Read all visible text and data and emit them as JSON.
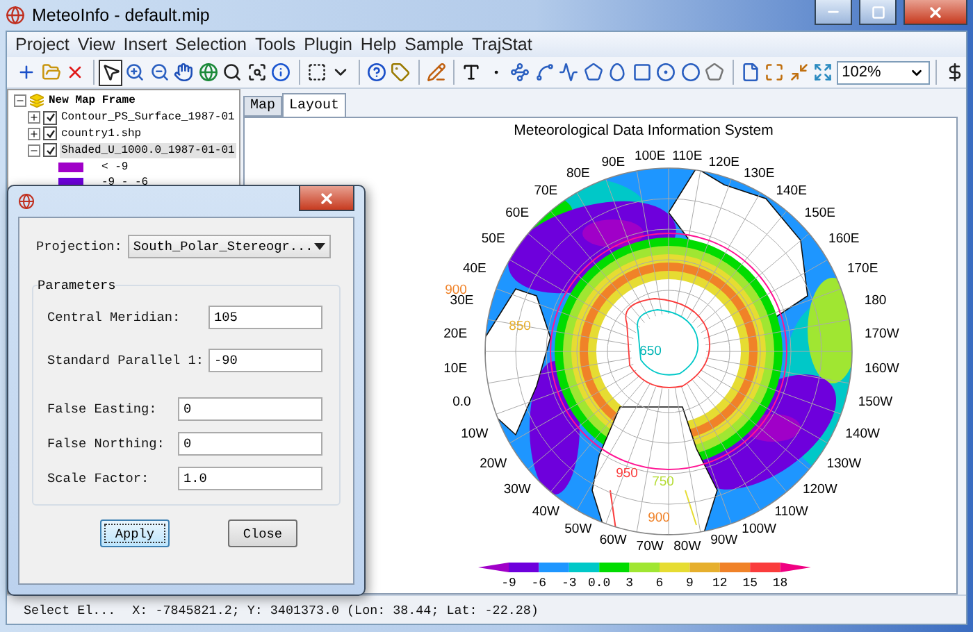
{
  "window": {
    "title": "MeteoInfo - default.mip"
  },
  "menu": [
    "Project",
    "View",
    "Insert",
    "Selection",
    "Tools",
    "Plugin",
    "Help",
    "Sample",
    "TrajStat"
  ],
  "toolbar": [
    {
      "kind": "add-layer",
      "selected": false
    },
    {
      "kind": "open-folder",
      "selected": false
    },
    {
      "kind": "remove-layer",
      "selected": false
    },
    {
      "kind": "separator"
    },
    {
      "kind": "pointer",
      "selected": true
    },
    {
      "kind": "zoom-in",
      "selected": false
    },
    {
      "kind": "zoom-out",
      "selected": false
    },
    {
      "kind": "pan",
      "selected": false
    },
    {
      "kind": "full-extent",
      "selected": false
    },
    {
      "kind": "magnifier",
      "selected": false
    },
    {
      "kind": "zoom-box",
      "selected": false
    },
    {
      "kind": "identify",
      "selected": false
    },
    {
      "kind": "separator"
    },
    {
      "kind": "select-rect",
      "selected": false
    },
    {
      "kind": "caret",
      "selected": false
    },
    {
      "kind": "separator"
    },
    {
      "kind": "help",
      "selected": false
    },
    {
      "kind": "label",
      "selected": false
    },
    {
      "kind": "separator"
    },
    {
      "kind": "edit",
      "selected": false
    },
    {
      "kind": "separator"
    },
    {
      "kind": "text",
      "selected": false
    },
    {
      "kind": "point",
      "selected": false
    },
    {
      "kind": "polyline",
      "selected": false
    },
    {
      "kind": "freehand",
      "selected": false
    },
    {
      "kind": "curve",
      "selected": false
    },
    {
      "kind": "polygon",
      "selected": false
    },
    {
      "kind": "ellipse",
      "selected": false
    },
    {
      "kind": "rectangle",
      "selected": false
    },
    {
      "kind": "circle",
      "selected": false
    },
    {
      "kind": "oval",
      "selected": false
    },
    {
      "kind": "pentagon",
      "selected": false
    },
    {
      "kind": "separator"
    },
    {
      "kind": "page",
      "selected": false
    },
    {
      "kind": "fit-page",
      "selected": false
    },
    {
      "kind": "zoom-page",
      "selected": false
    },
    {
      "kind": "full-page",
      "selected": false
    },
    {
      "kind": "zoom-combo",
      "value": "102%"
    },
    {
      "kind": "separator"
    },
    {
      "kind": "script",
      "selected": false
    }
  ],
  "tree": {
    "kind": "frame",
    "label": "New Map Frame",
    "expanded": true,
    "children": [
      {
        "kind": "layer",
        "label": "Contour_PS_Surface_1987-01",
        "checked": true,
        "expanded": false,
        "selected": false
      },
      {
        "kind": "layer",
        "label": "country1.shp",
        "checked": true,
        "expanded": false,
        "selected": false
      },
      {
        "kind": "layer",
        "label": "Shaded_U_1000.0_1987-01-01",
        "checked": true,
        "expanded": true,
        "selected": true,
        "children": [
          {
            "kind": "legend",
            "label": "< -9",
            "color": "#a000c8"
          },
          {
            "kind": "legend",
            "label": "-9 - -6",
            "color": "#6e00dc"
          }
        ]
      }
    ]
  },
  "tabs": [
    {
      "label": "Map",
      "selected": false
    },
    {
      "label": "Layout",
      "selected": true
    }
  ],
  "layout": {
    "title": "Meteorological Data Information System",
    "left_labels": [
      "90E",
      "80E",
      "70E",
      "60E",
      "50E",
      "40E",
      "30E",
      "20E",
      "10E",
      "0.0",
      "10W",
      "20W",
      "30W",
      "40W",
      "50W",
      "60W",
      "70W"
    ],
    "right_labels": [
      "100E",
      "110E",
      "120E",
      "130E",
      "140E",
      "150E",
      "160E",
      "170E",
      "180",
      "170W",
      "160W",
      "150W",
      "140W",
      "130W",
      "120W",
      "110W",
      "100W",
      "90W",
      "80W"
    ],
    "contour_labels": [
      {
        "text": "900",
        "color": "#f08228"
      },
      {
        "text": "850",
        "color": "#e6af2d"
      },
      {
        "text": "950",
        "color": "#fa3c3c"
      },
      {
        "text": "750",
        "color": "#b4dc32"
      },
      {
        "text": "900",
        "color": "#f08228"
      },
      {
        "text": "650",
        "color": "#00b4b4"
      }
    ],
    "colorbar": {
      "segments": [
        {
          "color": "#a000c8"
        },
        {
          "color": "#6e00dc"
        },
        {
          "color": "#1e96ff"
        },
        {
          "color": "#00c8c8"
        },
        {
          "color": "#00dc00"
        },
        {
          "color": "#a0e632"
        },
        {
          "color": "#e6dc32"
        },
        {
          "color": "#e6af2d"
        },
        {
          "color": "#f08228"
        },
        {
          "color": "#fa3c3c"
        },
        {
          "color": "#f00082"
        }
      ],
      "ticks": [
        "-9",
        "-6",
        "-3",
        "0.0",
        "3",
        "6",
        "9",
        "12",
        "15",
        "18"
      ]
    }
  },
  "status_bar": {
    "mode": "Select El...",
    "coordinates": "X: -7845821.2; Y: 3401373.0 (Lon: 38.44; Lat: -22.28)"
  },
  "dialog": {
    "projection_label": "Projection:",
    "projection": "South_Polar_Stereogr...",
    "parameters_title": "Parameters",
    "groups": [
      {
        "fields": [
          {
            "label": "Central Meridian:",
            "value": "105"
          },
          {
            "label": "Standard Parallel 1:",
            "value": "-90"
          }
        ]
      },
      {
        "fields": [
          {
            "label": "False Easting:",
            "value": "0"
          },
          {
            "label": "False Northing:",
            "value": "0"
          },
          {
            "label": "Scale Factor:",
            "value": "1.0"
          }
        ]
      }
    ],
    "buttons": [
      {
        "label": "Apply",
        "default": true
      },
      {
        "label": "Close",
        "default": false
      }
    ]
  }
}
